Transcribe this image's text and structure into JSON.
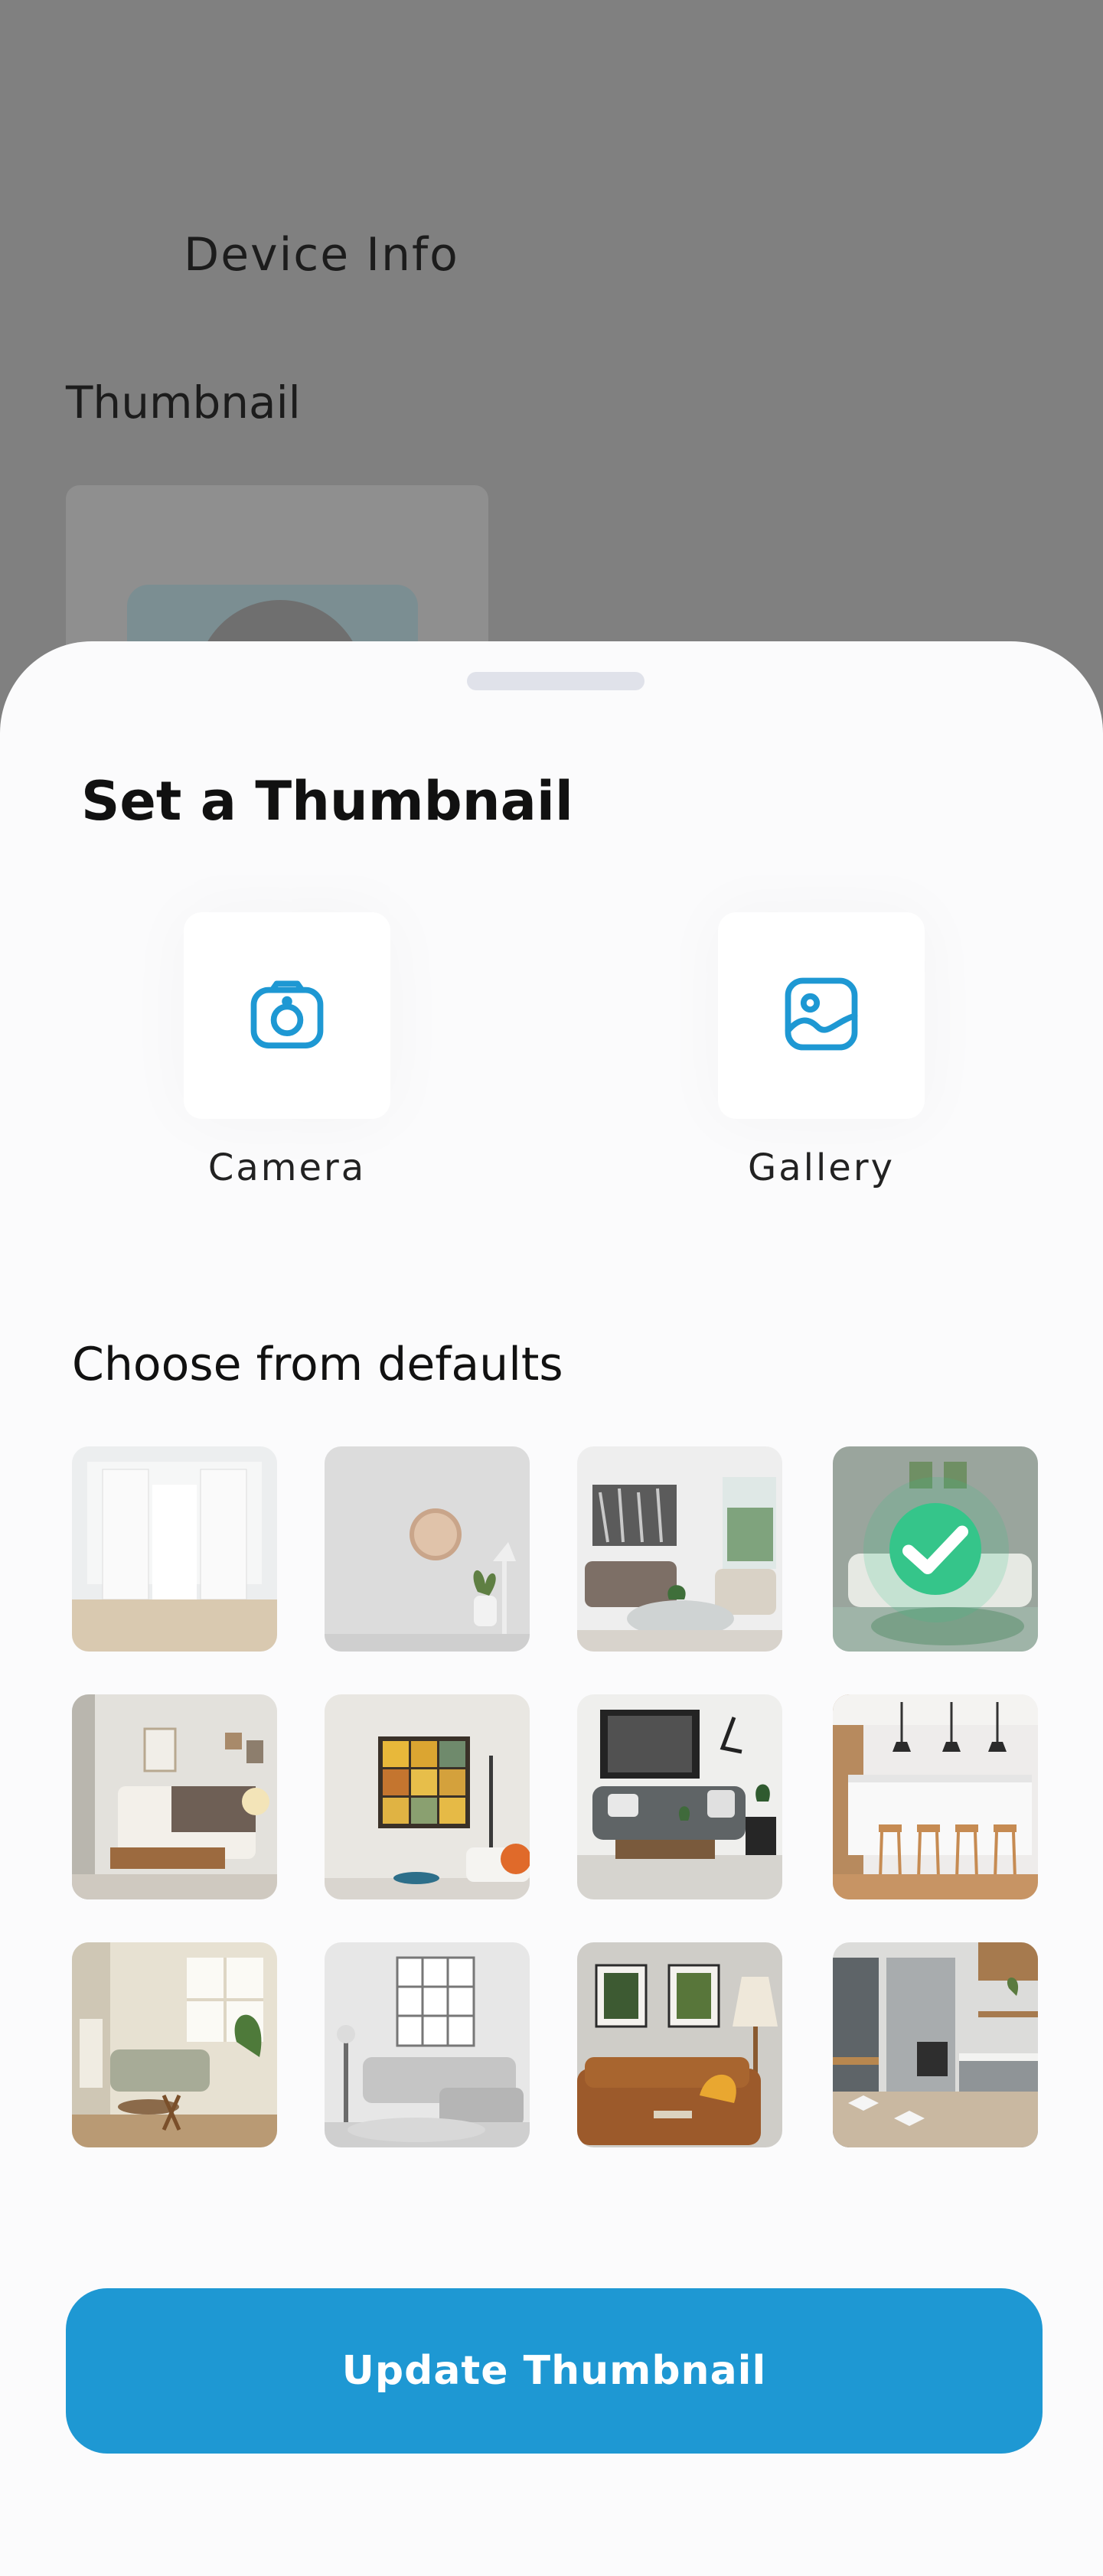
{
  "background": {
    "title": "Device Info",
    "section_label": "Thumbnail"
  },
  "sheet": {
    "title": "Set a Thumbnail",
    "options": [
      {
        "label": "Camera",
        "icon": "camera-icon"
      },
      {
        "label": "Gallery",
        "icon": "gallery-icon"
      }
    ],
    "defaults_title": "Choose from defaults",
    "defaults": [
      {
        "name": "white-doors-room"
      },
      {
        "name": "wall-clock-plant"
      },
      {
        "name": "living-room-art"
      },
      {
        "name": "green-living-room",
        "selected": true
      },
      {
        "name": "bedroom"
      },
      {
        "name": "yellow-art-room"
      },
      {
        "name": "dark-sofa-room"
      },
      {
        "name": "kitchen-stools"
      },
      {
        "name": "sunny-living-room"
      },
      {
        "name": "gray-sectional"
      },
      {
        "name": "leather-sofa"
      },
      {
        "name": "modern-kitchen"
      }
    ],
    "update_button": "Update Thumbnail"
  },
  "colors": {
    "accent": "#1e98d3",
    "check": "#35c58a",
    "scrim": "#808080"
  }
}
